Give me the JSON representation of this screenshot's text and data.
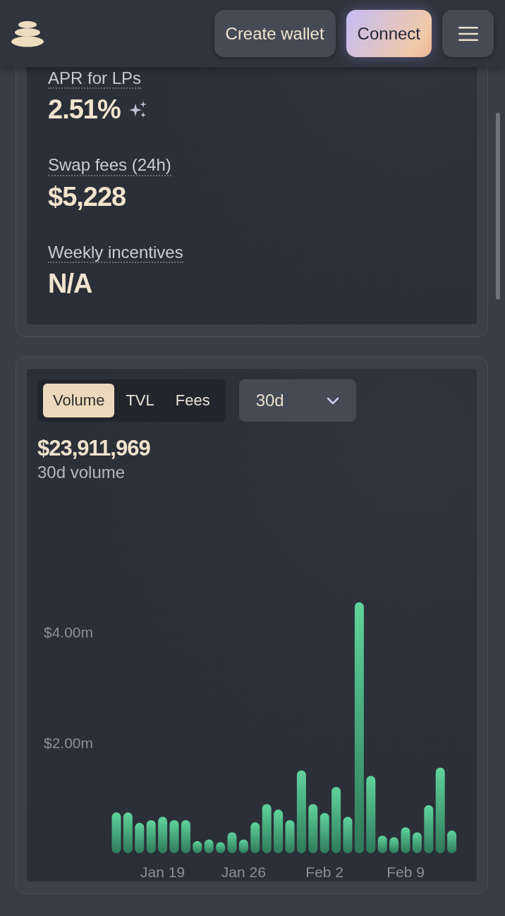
{
  "header": {
    "buttons": [
      {
        "label": "Create wallet",
        "kind": "secondary"
      },
      {
        "label": "Connect",
        "kind": "primary"
      }
    ]
  },
  "stats": [
    {
      "label": "APR for LPs",
      "value": "2.51%",
      "kind": "apr"
    },
    {
      "label": "Swap fees (24h)",
      "value": "$5,228",
      "kind": "plain"
    },
    {
      "label": "Weekly incentives",
      "value": "N/A",
      "kind": "plain"
    }
  ],
  "chart_card": {
    "tabs": [
      {
        "label": "Volume",
        "selected": true
      },
      {
        "label": "TVL",
        "selected": false
      },
      {
        "label": "Fees",
        "selected": false
      }
    ],
    "period": "30d",
    "total": "$23,911,969",
    "caption": "30d volume",
    "chart_data": {
      "type": "bar",
      "categories": [
        null,
        null,
        null,
        null,
        "Jan 19",
        null,
        null,
        null,
        null,
        null,
        null,
        "Jan 26",
        null,
        null,
        null,
        null,
        null,
        null,
        "Feb 2",
        null,
        null,
        null,
        null,
        null,
        null,
        "Feb 9",
        null,
        null,
        null,
        null
      ],
      "values": [
        0.74,
        0.74,
        0.55,
        0.6,
        0.66,
        0.6,
        0.6,
        0.22,
        0.25,
        0.2,
        0.38,
        0.25,
        0.56,
        0.89,
        0.79,
        0.6,
        1.5,
        0.89,
        0.73,
        1.2,
        0.66,
        4.54,
        1.4,
        0.32,
        0.29,
        0.47,
        0.38,
        0.87,
        1.55,
        0.41
      ],
      "ylim": [
        0,
        4.54
      ],
      "yticks": [
        {
          "value": 2,
          "label": "$2.00m"
        },
        {
          "value": 4,
          "label": "$4.00m"
        }
      ]
    }
  }
}
